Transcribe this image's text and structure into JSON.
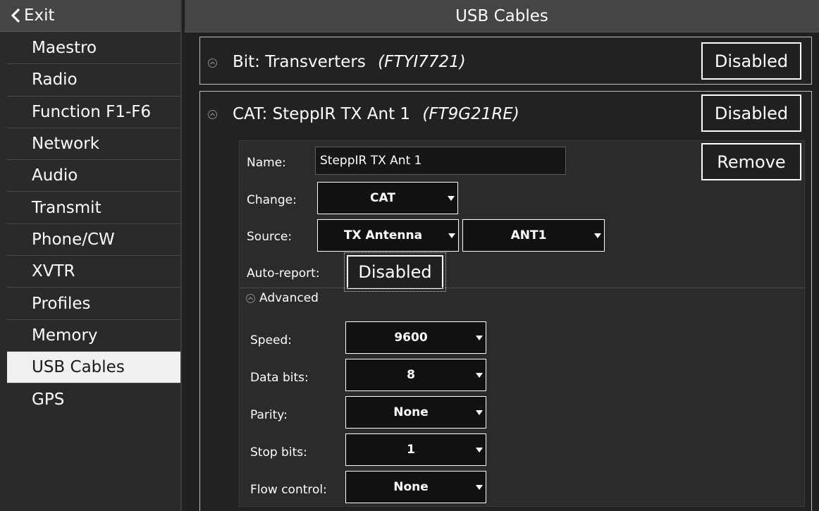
{
  "sidebar": {
    "exit_label": "Exit",
    "items": [
      {
        "label": "Maestro"
      },
      {
        "label": "Radio"
      },
      {
        "label": "Function F1-F6"
      },
      {
        "label": "Network"
      },
      {
        "label": "Audio"
      },
      {
        "label": "Transmit"
      },
      {
        "label": "Phone/CW"
      },
      {
        "label": "XVTR"
      },
      {
        "label": "Profiles"
      },
      {
        "label": "Memory"
      },
      {
        "label": "USB Cables"
      },
      {
        "label": "GPS"
      }
    ],
    "active": "USB Cables"
  },
  "header": {
    "title": "USB Cables"
  },
  "cables": [
    {
      "type_label": "Bit:",
      "name": "Transverters",
      "serial": "(FTYI7721)",
      "status_label": "Disabled"
    },
    {
      "type_label": "CAT:",
      "name": "SteppIR TX Ant 1",
      "serial": "(FT9G21RE)",
      "status_label": "Disabled",
      "remove_label": "Remove",
      "fields": {
        "name_label": "Name:",
        "name_value": "SteppIR TX Ant 1",
        "change_label": "Change:",
        "change_value": "CAT",
        "source_label": "Source:",
        "source_value": "TX Antenna",
        "source_sub_value": "ANT1",
        "autoreport_label": "Auto-report:",
        "autoreport_value": "Disabled"
      },
      "advanced": {
        "label": "Advanced",
        "speed_label": "Speed:",
        "speed_value": "9600",
        "databits_label": "Data bits:",
        "databits_value": "8",
        "parity_label": "Parity:",
        "parity_value": "None",
        "stopbits_label": "Stop bits:",
        "stopbits_value": "1",
        "flow_label": "Flow control:",
        "flow_value": "None"
      }
    }
  ],
  "colors": {
    "background": "#202020",
    "header_bg": "#454545",
    "active_item_bg": "#f0f0f0",
    "panel_border": "#bdbdbd"
  },
  "icons": {
    "exit": "chevron-left-icon",
    "collapse": "circle-chevron-icon",
    "dropdown": "triangle-down-icon"
  }
}
